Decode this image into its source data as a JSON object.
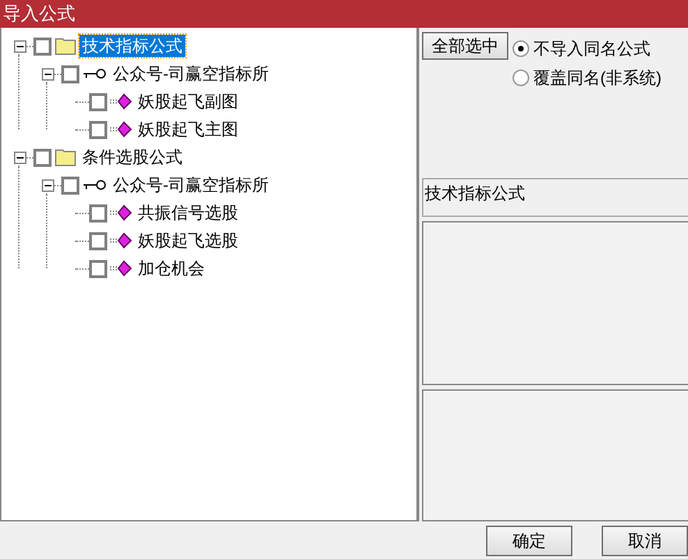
{
  "window": {
    "title": "导入公式"
  },
  "tree": [
    {
      "label": "技术指标公式",
      "kind": "folder",
      "checked": false,
      "expanded": true,
      "selected": true,
      "children": [
        {
          "label": "公众号-司赢空指标所",
          "kind": "group",
          "checked": false,
          "expanded": true,
          "selected": false,
          "children": [
            {
              "label": "妖股起飞副图",
              "kind": "formula",
              "checked": false,
              "selected": false
            },
            {
              "label": "妖股起飞主图",
              "kind": "formula",
              "checked": false,
              "selected": false
            }
          ]
        }
      ]
    },
    {
      "label": "条件选股公式",
      "kind": "folder",
      "checked": false,
      "expanded": true,
      "selected": false,
      "children": [
        {
          "label": "公众号-司赢空指标所",
          "kind": "group",
          "checked": false,
          "expanded": true,
          "selected": false,
          "children": [
            {
              "label": "共振信号选股",
              "kind": "formula",
              "checked": false,
              "selected": false
            },
            {
              "label": "妖股起飞选股",
              "kind": "formula",
              "checked": false,
              "selected": false
            },
            {
              "label": "加仓机会",
              "kind": "formula",
              "checked": false,
              "selected": false
            }
          ]
        }
      ]
    }
  ],
  "select_all_button": "全部选中",
  "options": [
    {
      "label": "不导入同名公式",
      "selected": true
    },
    {
      "label": "覆盖同名(非系统)",
      "selected": false
    }
  ],
  "formula_type": "技术指标公式",
  "buttons": [
    "确定",
    "取消"
  ]
}
